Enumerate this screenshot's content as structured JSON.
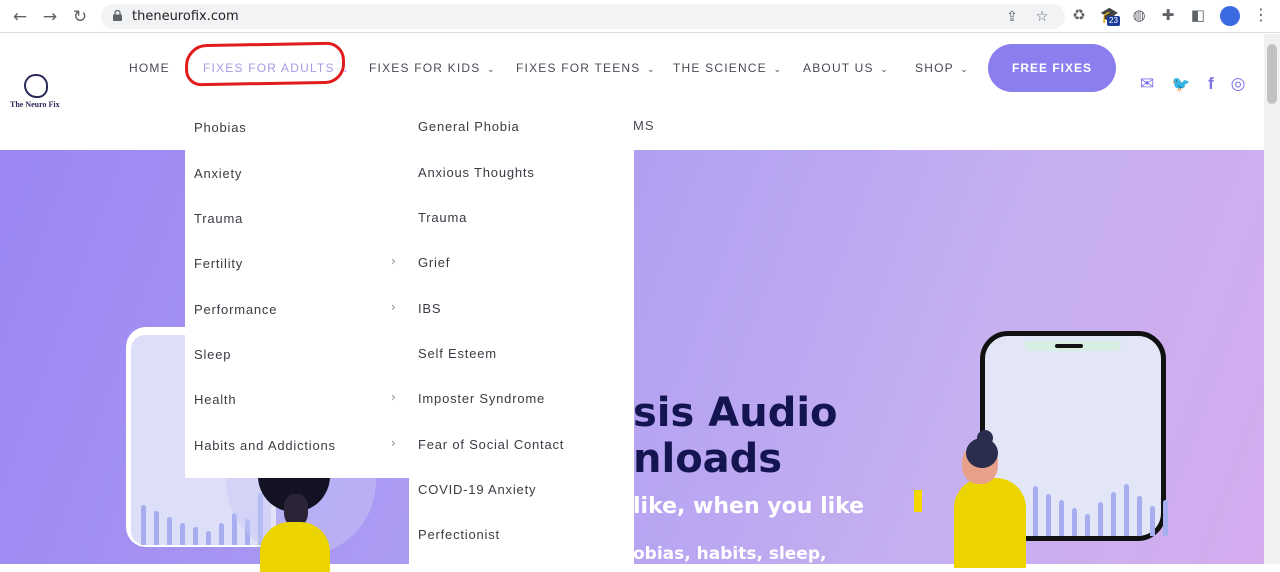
{
  "browser": {
    "url": "theneurofix.com",
    "back_icon": "←",
    "forward_icon": "→",
    "reload_icon": "↻",
    "share_icon": "⇪",
    "star_icon": "☆",
    "ext_badge": "23",
    "menu_icon": "⋮"
  },
  "site": {
    "logo_text": "The Neuro Fix",
    "nav": {
      "home": "HOME",
      "adults": "FIXES FOR ADULTS",
      "kids": "FIXES FOR KIDS",
      "teens": "FIXES FOR TEENS",
      "science": "THE SCIENCE",
      "about": "ABOUT US",
      "shop": "SHOP",
      "chevron": "⌄",
      "free": "FREE FIXES"
    },
    "social": {
      "email": "✉",
      "twitter": "🐦",
      "facebook": "f",
      "instagram": "◎"
    },
    "ms_fragment": "MS"
  },
  "dropdown": {
    "categories": [
      {
        "label": "Phobias",
        "has_sub": false
      },
      {
        "label": "Anxiety",
        "has_sub": false
      },
      {
        "label": "Trauma",
        "has_sub": false
      },
      {
        "label": "Fertility",
        "has_sub": true
      },
      {
        "label": "Performance",
        "has_sub": true
      },
      {
        "label": "Sleep",
        "has_sub": false
      },
      {
        "label": "Health",
        "has_sub": true
      },
      {
        "label": "Habits and Addictions",
        "has_sub": true
      }
    ],
    "chevron": "›",
    "subitems": [
      "General Phobia",
      "Anxious Thoughts",
      "Trauma",
      "Grief",
      "IBS",
      "Self Esteem",
      "Imposter Syndrome",
      "Fear of Social Contact",
      "COVID-19 Anxiety",
      "Perfectionist"
    ]
  },
  "hero": {
    "title_line1": "sis Audio",
    "title_line2": "nloads",
    "subtitle": "like, when you like",
    "subtitle2": "obias, habits, sleep,"
  }
}
